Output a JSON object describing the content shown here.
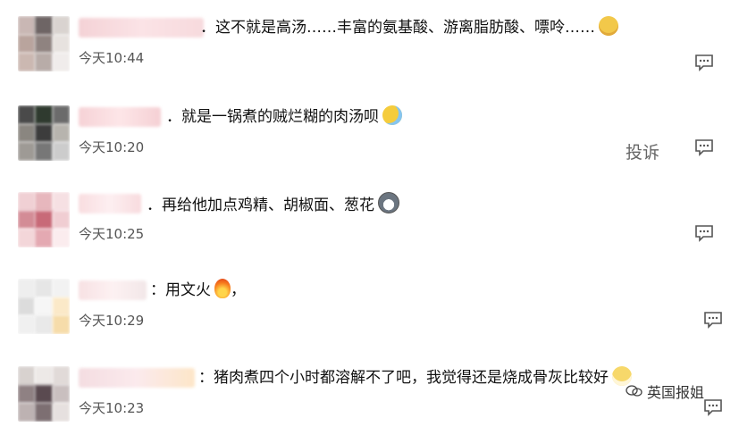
{
  "comments": [
    {
      "text": "．这不就是高汤……丰富的氨基酸、游离脂肪酸、嘌呤……",
      "emoji": "dog-face-emoji",
      "time": "今天10:44"
    },
    {
      "text": "．就是一锅煮的贼烂糊的肉汤呗",
      "emoji": "sweat-face-emoji",
      "time": "今天10:20"
    },
    {
      "text": "．再给他加点鸡精、胡椒面、葱花",
      "emoji": "husky-face-emoji",
      "time": "今天10:25"
    },
    {
      "text": "：用文火",
      "emoji": "fire-emoji",
      "suffix": "，",
      "time": "今天10:29"
    },
    {
      "text": "：猪肉煮四个小时都溶解不了吧，我觉得还是烧成骨灰比较好",
      "emoji": "grin-face-emoji",
      "time": "今天10:23"
    }
  ],
  "report_label": "投诉",
  "watermark": "英国报姐",
  "icons": {
    "reply": "comment-reply-icon"
  },
  "colors": {
    "time_text": "#555555",
    "report_text": "#666666",
    "icon_stroke": "#555555"
  }
}
